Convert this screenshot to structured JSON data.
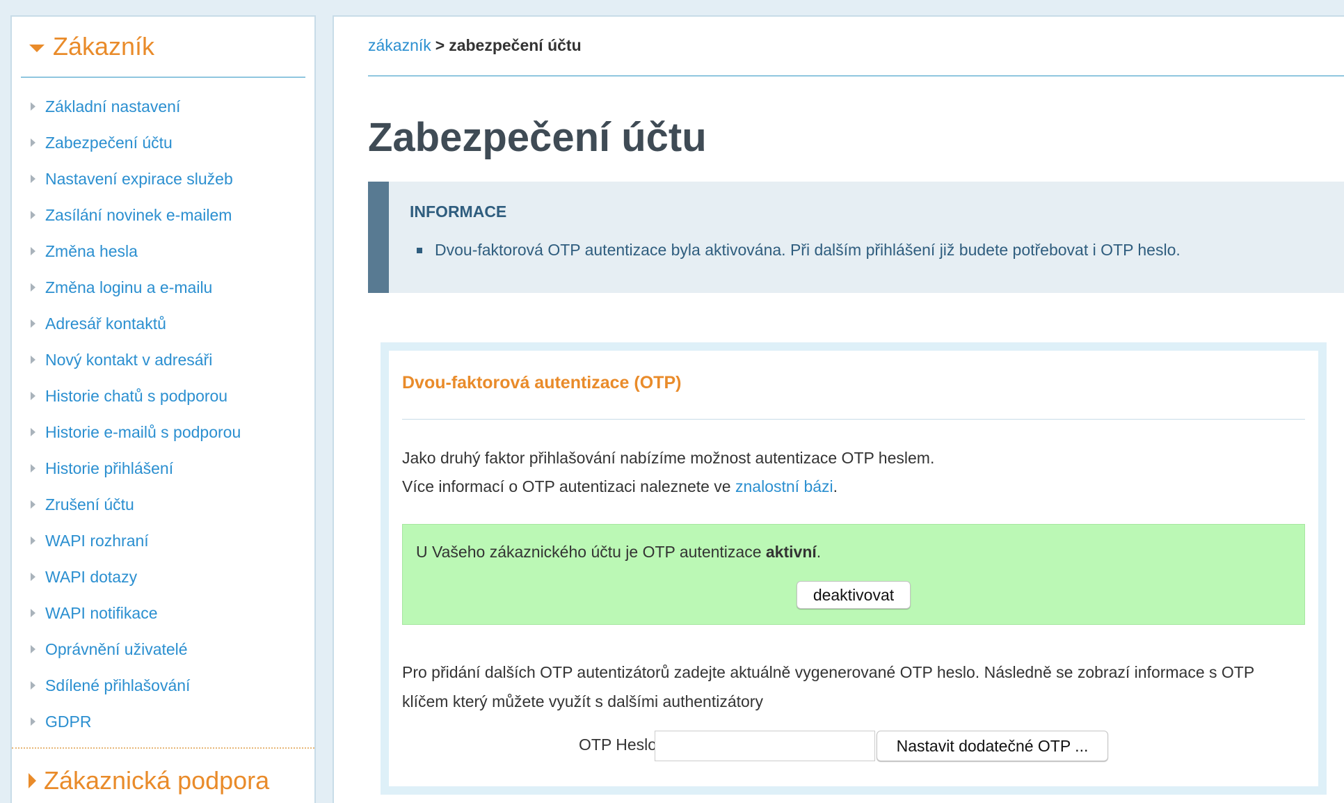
{
  "sidebar": {
    "section_title": "Zákazník",
    "items": [
      {
        "label": "Základní nastavení"
      },
      {
        "label": "Zabezpečení účtu"
      },
      {
        "label": "Nastavení expirace služeb"
      },
      {
        "label": "Zasílání novinek e-mailem"
      },
      {
        "label": "Změna hesla"
      },
      {
        "label": "Změna loginu a e-mailu"
      },
      {
        "label": "Adresář kontaktů"
      },
      {
        "label": "Nový kontakt v adresáři"
      },
      {
        "label": "Historie chatů s podporou"
      },
      {
        "label": "Historie e-mailů s podporou"
      },
      {
        "label": "Historie přihlášení"
      },
      {
        "label": "Zrušení účtu"
      },
      {
        "label": "WAPI rozhraní"
      },
      {
        "label": "WAPI dotazy"
      },
      {
        "label": "WAPI notifikace"
      },
      {
        "label": "Oprávnění uživatelé"
      },
      {
        "label": "Sdílené přihlašování"
      },
      {
        "label": "GDPR"
      }
    ],
    "section2_title": "Zákaznická podpora"
  },
  "breadcrumb": {
    "parent": "zákazník",
    "separator": ">",
    "current": "zabezpečení účtu"
  },
  "page": {
    "title": "Zabezpečení účtu"
  },
  "info": {
    "title": "INFORMACE",
    "message": "Dvou-faktorová OTP autentizace byla aktivována. Při dalším přihlášení již budete potřebovat i OTP heslo."
  },
  "otp": {
    "title": "Dvou-faktorová autentizace (OTP)",
    "line1": "Jako druhý faktor přihlašování nabízíme možnost autentizace OTP heslem.",
    "line2_prefix": "Více informací o OTP autentizaci naleznete ve ",
    "line2_link": "znalostní bázi",
    "line2_suffix": ".",
    "status_prefix": "U Vašeho zákaznického účtu je OTP autentizace ",
    "status_value": "aktivní",
    "status_suffix": ".",
    "deactivate_label": "deaktivovat",
    "description": "Pro přidání dalších OTP autentizátorů zadejte aktuálně vygenerované OTP heslo. Následně se zobrazí informace s OTP klíčem který můžete využít s dalšími authentizátory",
    "password_label": "OTP Heslo:",
    "password_value": "",
    "submit_label": "Nastavit dodatečné OTP ..."
  },
  "colors": {
    "accent_orange": "#e98b2a",
    "link_blue": "#2b8fd0",
    "success_green": "#bbf8b5",
    "info_bar": "#587a92"
  }
}
